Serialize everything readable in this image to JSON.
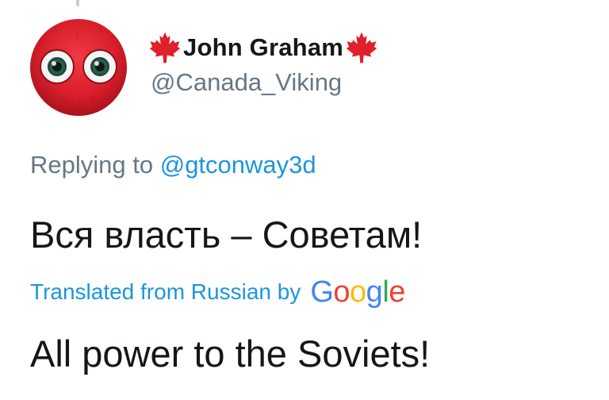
{
  "user": {
    "display_name": "John Graham",
    "handle": "@Canada_Viking",
    "name_icon_left": "maple-leaf-icon",
    "name_icon_right": "maple-leaf-icon",
    "avatar": "red-fuzzy-creature-avatar"
  },
  "reply": {
    "prefix": "Replying to",
    "mention": "@gtconway3d"
  },
  "tweet": {
    "text": "Вся власть – Советам!",
    "translated_label": "Translated from Russian by",
    "translator_logo": {
      "letters": [
        "G",
        "o",
        "o",
        "g",
        "l",
        "e"
      ],
      "colors": [
        "#4285F4",
        "#EA4335",
        "#FBBC05",
        "#4285F4",
        "#34A853",
        "#EA4335"
      ]
    },
    "translation": "All power to the Soviets!"
  },
  "colors": {
    "text_primary": "#14171a",
    "text_secondary": "#657786",
    "link": "#1b95e0",
    "maple_leaf": "#e0202a",
    "avatar_red": "#d81e2b"
  }
}
